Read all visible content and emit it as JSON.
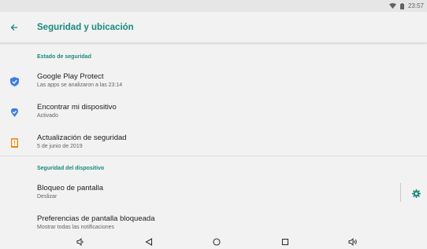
{
  "status_bar": {
    "time": "23:57"
  },
  "app_bar": {
    "title": "Seguridad y ubicación"
  },
  "sections": [
    {
      "header": "Estado de seguridad",
      "items": [
        {
          "title": "Google Play Protect",
          "summary": "Las apps se analizaron a las 23:14",
          "icon": "shield-check-icon"
        },
        {
          "title": "Encontrar mi dispositivo",
          "summary": "Activado",
          "icon": "location-check-icon"
        },
        {
          "title": "Actualización de seguridad",
          "summary": "5 de junio de 2019",
          "icon": "phone-update-icon"
        }
      ]
    },
    {
      "header": "Seguridad del dispositivo",
      "items": [
        {
          "title": "Bloqueo de pantalla",
          "summary": "Deslizar",
          "icon": "gear-icon"
        },
        {
          "title": "Preferencias de pantalla bloqueada",
          "summary": "Mostrar todas las notificaciones"
        }
      ]
    }
  ],
  "nav_bar": {
    "buttons": [
      "volume-down-icon",
      "back-triangle-icon",
      "home-circle-icon",
      "recents-square-icon",
      "volume-up-icon"
    ]
  },
  "colors": {
    "accent": "#1a8a7c",
    "icon_blue": "#3f7de0",
    "icon_orange": "#e8850c",
    "background": "#f2f2f2"
  }
}
